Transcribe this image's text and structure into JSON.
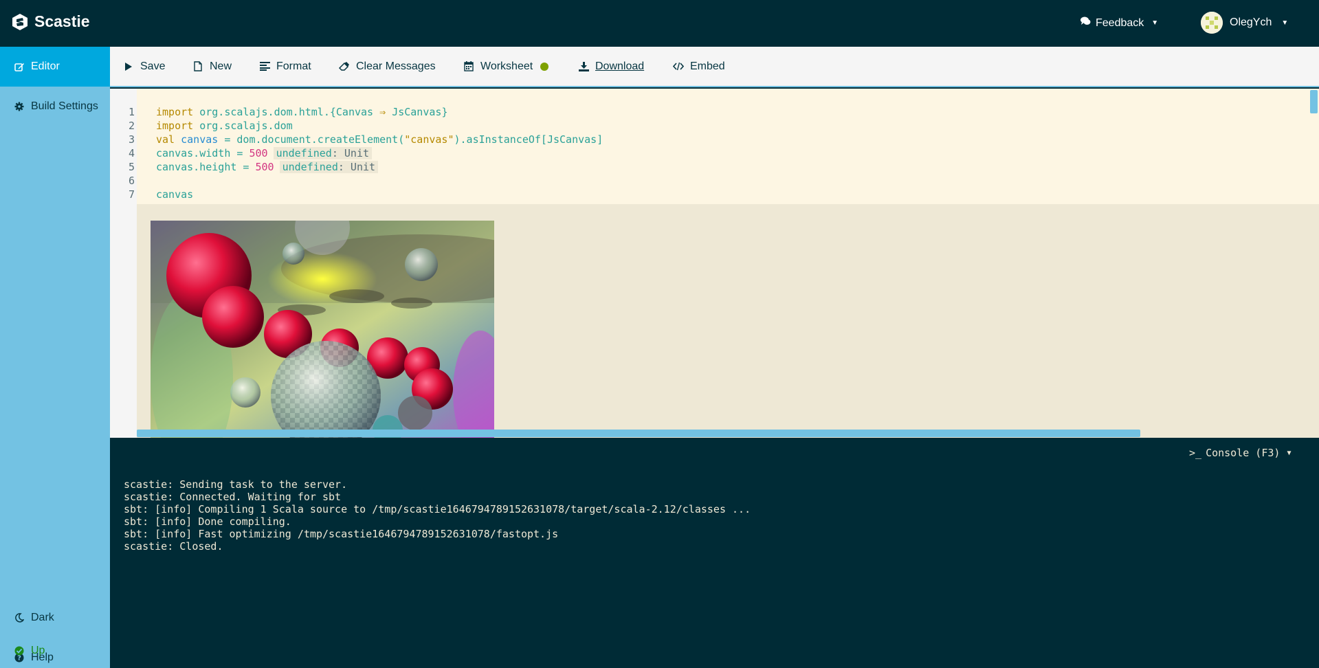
{
  "app": {
    "name": "Scastie"
  },
  "topbar": {
    "feedback_label": "Feedback",
    "user_name": "OlegYch"
  },
  "sidebar": {
    "items": [
      {
        "label": "Editor",
        "icon": "edit-icon",
        "active": true
      },
      {
        "label": "Build Settings",
        "icon": "gear-icon",
        "active": false
      }
    ],
    "bottom": [
      {
        "label": "Dark",
        "icon": "moon-icon"
      },
      {
        "label": "Help",
        "icon": "question-icon"
      },
      {
        "label": "Up",
        "icon": "check-circle-icon"
      }
    ]
  },
  "toolbar": {
    "save": "Save",
    "new": "New",
    "format": "Format",
    "clear": "Clear Messages",
    "worksheet": "Worksheet",
    "download": "Download",
    "embed": "Embed"
  },
  "editor": {
    "line_numbers": [
      "1",
      "2",
      "3",
      "4",
      "5",
      "6",
      "7"
    ],
    "lines": [
      [
        [
          "kw",
          "import "
        ],
        [
          "op",
          "org.scalajs.dom.html.{"
        ],
        [
          "tpe",
          "Canvas"
        ],
        [
          "kw",
          " ⇒ "
        ],
        [
          "tpe",
          "JsCanvas"
        ],
        [
          "op",
          "}"
        ]
      ],
      [
        [
          "kw",
          "import "
        ],
        [
          "op",
          "org.scalajs.dom"
        ]
      ],
      [
        [
          "kw",
          "val "
        ],
        [
          "id",
          "canvas"
        ],
        [
          "op",
          " = dom.document.createElement("
        ],
        [
          "str",
          "\"canvas\""
        ],
        [
          "op",
          ").asInstanceOf["
        ],
        [
          "tpe",
          "JsCanvas"
        ],
        [
          "op",
          "]"
        ]
      ],
      [
        [
          "op",
          "canvas.width = "
        ],
        [
          "num",
          "500"
        ]
      ],
      [
        [
          "op",
          "canvas.height = "
        ],
        [
          "num",
          "500"
        ]
      ],
      [],
      [
        [
          "op",
          "canvas"
        ]
      ]
    ],
    "inline_results": {
      "line4": {
        "value": "undefined",
        "type": ": Unit"
      },
      "line5": {
        "value": "undefined",
        "type": ": Unit"
      }
    }
  },
  "console": {
    "toggle_label": "Console (F3)",
    "lines": [
      "scastie: Sending task to the server.",
      "scastie: Connected. Waiting for sbt",
      "sbt: [info] Compiling 1 Scala source to /tmp/scastie1646794789152631078/target/scala-2.12/classes ...",
      "sbt: [info] Done compiling.",
      "sbt: [info] Fast optimizing /tmp/scastie1646794789152631078/fastopt.js",
      "scastie: Closed."
    ]
  },
  "colors": {
    "topbar": "#002b36",
    "sidebar": "#73c2e3",
    "sidebar_active": "#00a8de",
    "worksheet_dot": "#7ea100",
    "status_up": "#1b8a1b"
  }
}
